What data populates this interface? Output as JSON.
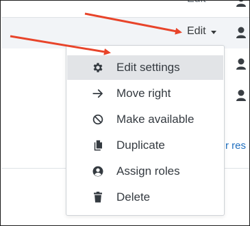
{
  "top_row": {
    "edit_label": "Edit"
  },
  "toggle": {
    "edit_label": "Edit"
  },
  "menu": {
    "items": [
      {
        "label": "Edit settings",
        "icon": "gear-icon",
        "active": true
      },
      {
        "label": "Move right",
        "icon": "arrow-right-icon"
      },
      {
        "label": "Make available",
        "icon": "ban-icon"
      },
      {
        "label": "Duplicate",
        "icon": "copy-icon"
      },
      {
        "label": "Assign roles",
        "icon": "user-circle-icon"
      },
      {
        "label": "Delete",
        "icon": "trash-icon"
      }
    ]
  },
  "behind_link": {
    "text": "r res"
  },
  "colors": {
    "annotation_arrow": "#e8442a",
    "highlight_row": "#f2f4f7",
    "active_item": "#e2e4e7",
    "link": "#1f6fbf"
  }
}
